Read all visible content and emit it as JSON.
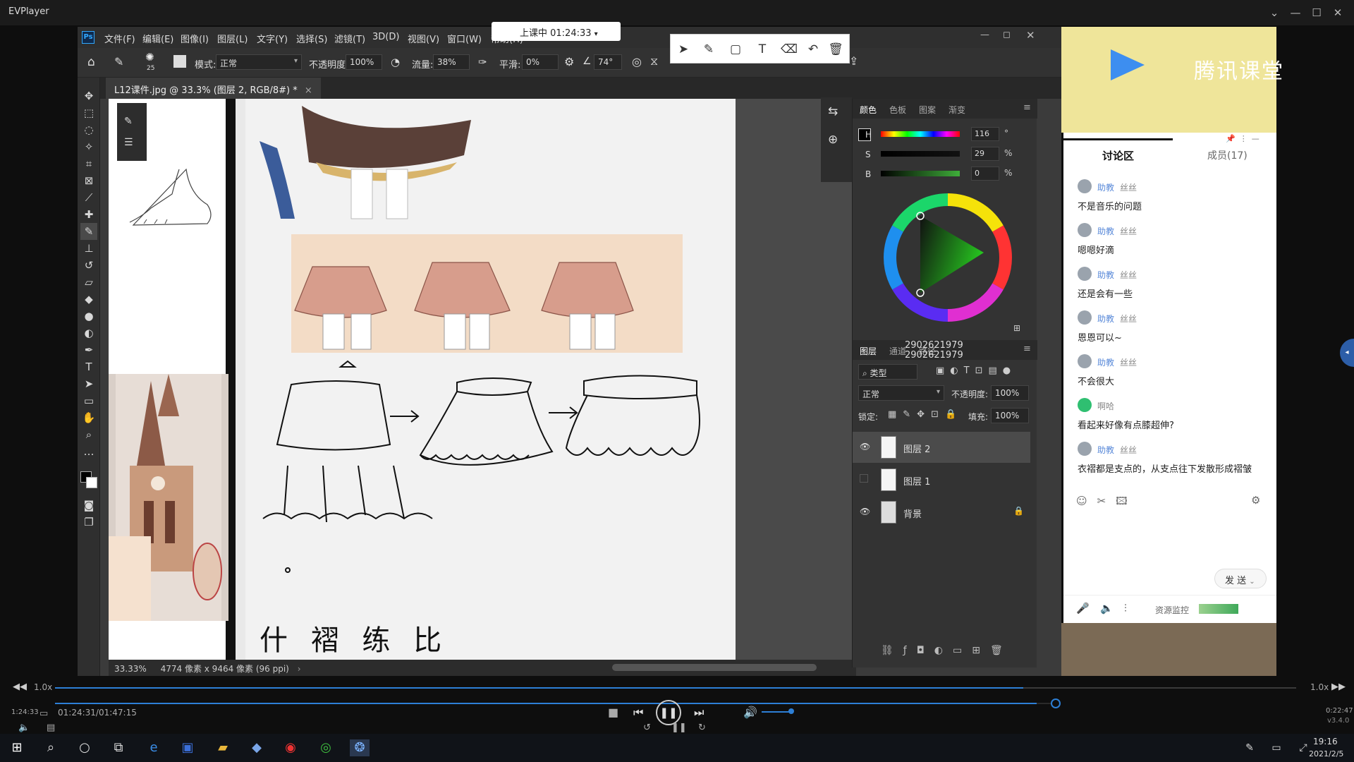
{
  "player": {
    "title": "EVPlayer",
    "speed_left": "1.0x",
    "speed_right": "1.0x",
    "time_display": "01:24:31/01:47:15",
    "version": "v3.4.0",
    "left_small_time": "1:24:33",
    "right_small_time": "0:22:47",
    "progress_fraction": 0.78
  },
  "photoshop": {
    "logo": "Ps",
    "menu": [
      "文件(F)",
      "编辑(E)",
      "图像(I)",
      "图层(L)",
      "文字(Y)",
      "选择(S)",
      "滤镜(T)",
      "3D(D)",
      "视图(V)",
      "窗口(W)",
      "帮助(H)"
    ],
    "options": {
      "brush_size": "25",
      "mode_label": "模式:",
      "mode_value": "正常",
      "opacity_label": "不透明度:",
      "opacity_value": "100%",
      "flow_label": "流量:",
      "flow_value": "38%",
      "smooth_label": "平滑:",
      "smooth_value": "0%",
      "angle_value": "74°"
    },
    "doc_tab": "L12课件.jpg @ 33.3% (图层 2, RGB/8#) *",
    "status": {
      "zoom": "33.33%",
      "doc_size": "4774 像素 x 9464 像素 (96 ppi)"
    },
    "color_panel": {
      "tabs": [
        "颜色",
        "色板",
        "图案",
        "渐变"
      ],
      "h_value": "116",
      "h_unit": "°",
      "s_value": "29",
      "s_unit": "%",
      "b_value": "0",
      "b_unit": "%",
      "h_label": "H",
      "s_label": "S",
      "b_label": "B"
    },
    "layers_panel": {
      "tabs": [
        "图层",
        "通道",
        "路径"
      ],
      "overlay_numbers": [
        "2902621979",
        "2902621979"
      ],
      "filter_label": "类型",
      "blend_mode": "正常",
      "opacity_label": "不透明度:",
      "opacity_value": "100%",
      "lock_label": "锁定:",
      "fill_label": "填充:",
      "fill_value": "100%",
      "layers": [
        {
          "name": "图层 2",
          "visible": true,
          "selected": true
        },
        {
          "name": "图层 1",
          "visible": false,
          "selected": false
        },
        {
          "name": "背景",
          "visible": true,
          "selected": false,
          "locked": true
        }
      ]
    },
    "canvas": {
      "handwriting": "什 褶 练 比"
    }
  },
  "live": {
    "status_text": "上课中 01:24:33"
  },
  "tencent": {
    "brand": "腾讯课堂",
    "tabs": [
      "讨论区",
      "成员(17)"
    ],
    "messages": [
      {
        "role": "助教",
        "name": "丝丝",
        "text": "不是音乐的问题"
      },
      {
        "role": "助教",
        "name": "丝丝",
        "text": "嗯嗯好滴"
      },
      {
        "role": "助教",
        "name": "丝丝",
        "text": "还是会有一些"
      },
      {
        "role": "助教",
        "name": "丝丝",
        "text": "恩恩可以~"
      },
      {
        "role": "助教",
        "name": "丝丝",
        "text": "不会很大"
      },
      {
        "role": "",
        "name": "啊哈",
        "text": "看起来好像有点膝超伸?"
      },
      {
        "role": "助教",
        "name": "丝丝",
        "text": "衣褶都是支点的，从支点往下发散形成褶皱"
      }
    ],
    "send_label": "发 送",
    "resource_monitor": "资源监控"
  },
  "taskbar": {
    "time": "19:16",
    "date": "2021/2/5"
  },
  "colors": {
    "accent_blue": "#31a8ff",
    "progress_blue": "#2d7fd6",
    "chat_accent": "#5a8ad9",
    "live_green": "#2fbf71"
  }
}
